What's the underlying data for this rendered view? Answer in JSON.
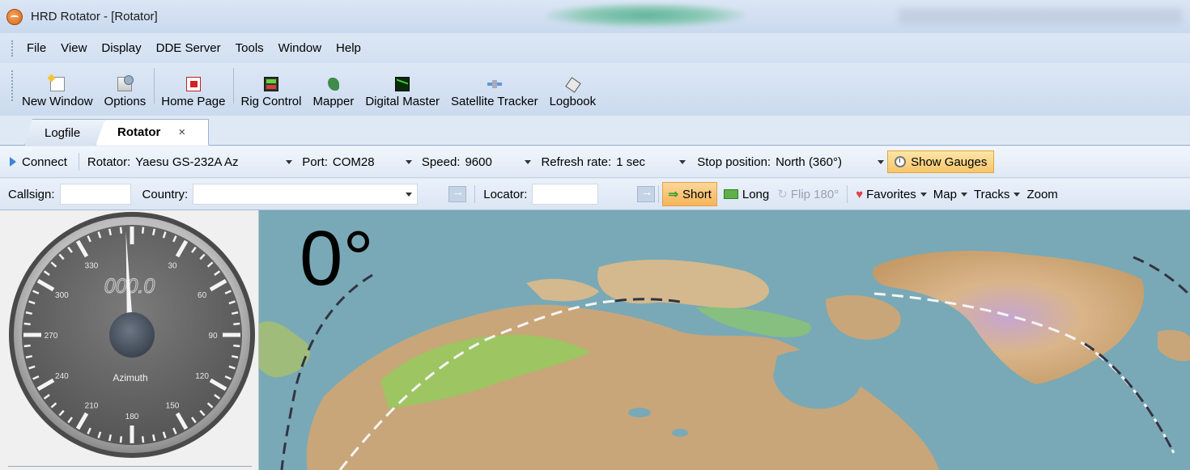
{
  "window": {
    "title": "HRD Rotator - [Rotator]"
  },
  "menu": [
    "File",
    "View",
    "Display",
    "DDE Server",
    "Tools",
    "Window",
    "Help"
  ],
  "toolbar": [
    {
      "label": "New Window",
      "icon": "new-window-icon"
    },
    {
      "label": "Options",
      "icon": "options-icon"
    },
    {
      "label": "Home Page",
      "icon": "home-page-icon"
    },
    {
      "label": "Rig Control",
      "icon": "rig-control-icon"
    },
    {
      "label": "Mapper",
      "icon": "mapper-icon"
    },
    {
      "label": "Digital Master",
      "icon": "digital-master-icon"
    },
    {
      "label": "Satellite Tracker",
      "icon": "satellite-tracker-icon"
    },
    {
      "label": "Logbook",
      "icon": "logbook-icon"
    }
  ],
  "tabs": [
    {
      "label": "Logfile",
      "active": false
    },
    {
      "label": "Rotator",
      "active": true,
      "close": "×"
    }
  ],
  "connect_bar": {
    "connect_label": "Connect",
    "rotator_label": "Rotator:",
    "rotator_value": "Yaesu GS-232A Az",
    "port_label": "Port:",
    "port_value": "COM28",
    "speed_label": "Speed:",
    "speed_value": "9600",
    "refresh_label": "Refresh rate:",
    "refresh_value": "1 sec",
    "stop_label": "Stop position:",
    "stop_value": "North (360°)",
    "show_gauges_label": "Show Gauges"
  },
  "call_bar": {
    "callsign_label": "Callsign:",
    "callsign_value": "",
    "country_label": "Country:",
    "country_value": "",
    "locator_label": "Locator:",
    "locator_value": "",
    "short_label": "Short",
    "long_label": "Long",
    "flip_label": "Flip 180°",
    "favorites_label": "Favorites",
    "map_label": "Map",
    "tracks_label": "Tracks",
    "zoom_label": "Zoom"
  },
  "gauge": {
    "label": "Azimuth",
    "digital_readout": "000.0",
    "azimuth_deg": 0,
    "tick_labels": [
      "330",
      "30",
      "300",
      "60",
      "270",
      "90",
      "240",
      "120",
      "210",
      "150",
      "180"
    ]
  },
  "map": {
    "heading_readout": "0°",
    "colors": {
      "ocean": "#79a9b6",
      "land_low": "#8fcf5a",
      "land_high": "#c9a77b",
      "ice": "#c6a6d0"
    }
  }
}
